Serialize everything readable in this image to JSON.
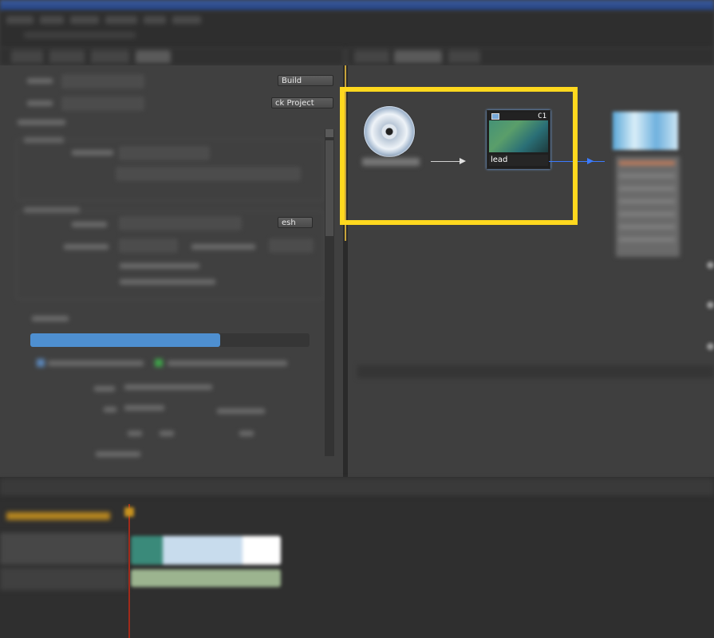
{
  "left_panel": {
    "buttons": {
      "build": "Build",
      "pack_project": "ck Project",
      "refresh": "esh"
    },
    "progress_fraction": 0.68
  },
  "flowchart": {
    "node": {
      "label": "lead",
      "badge": "C1",
      "icon": "clip-icon"
    },
    "disc_icon": "disc-icon",
    "arrow_color": "#3b7bff",
    "highlight_color": "#ffd81e"
  },
  "colors": {
    "progress": "#4e8fd0",
    "playhead": "#a02a1a",
    "title_bar": "#24427f"
  }
}
